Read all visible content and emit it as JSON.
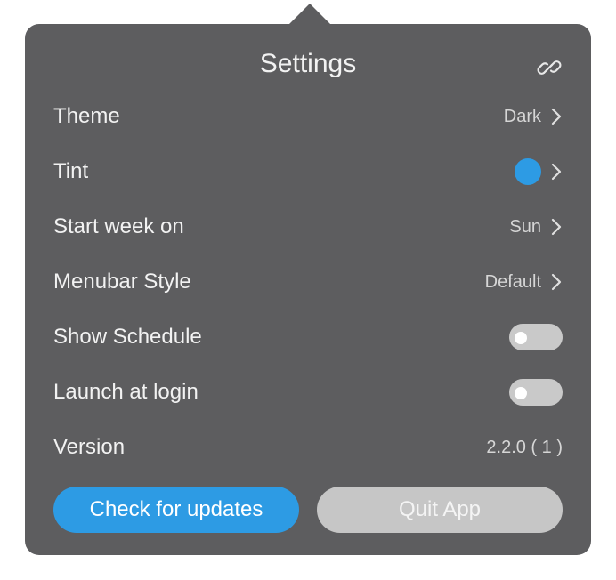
{
  "header": {
    "title": "Settings",
    "link_icon": "link-icon"
  },
  "rows": {
    "theme": {
      "label": "Theme",
      "value": "Dark"
    },
    "tint": {
      "label": "Tint",
      "color": "#2d9be4"
    },
    "start_week": {
      "label": "Start week on",
      "value": "Sun"
    },
    "menubar_style": {
      "label": "Menubar Style",
      "value": "Default"
    },
    "show_schedule": {
      "label": "Show Schedule",
      "enabled": false
    },
    "launch_at_login": {
      "label": "Launch at login",
      "enabled": false
    },
    "version": {
      "label": "Version",
      "value": "2.2.0 ( 1 )"
    }
  },
  "buttons": {
    "check_updates": "Check for updates",
    "quit": "Quit App"
  },
  "colors": {
    "panel_background": "#5d5d5f",
    "accent": "#2d9be4",
    "toggle_off": "#c9c9c9",
    "quit_button": "#c6c6c6"
  }
}
